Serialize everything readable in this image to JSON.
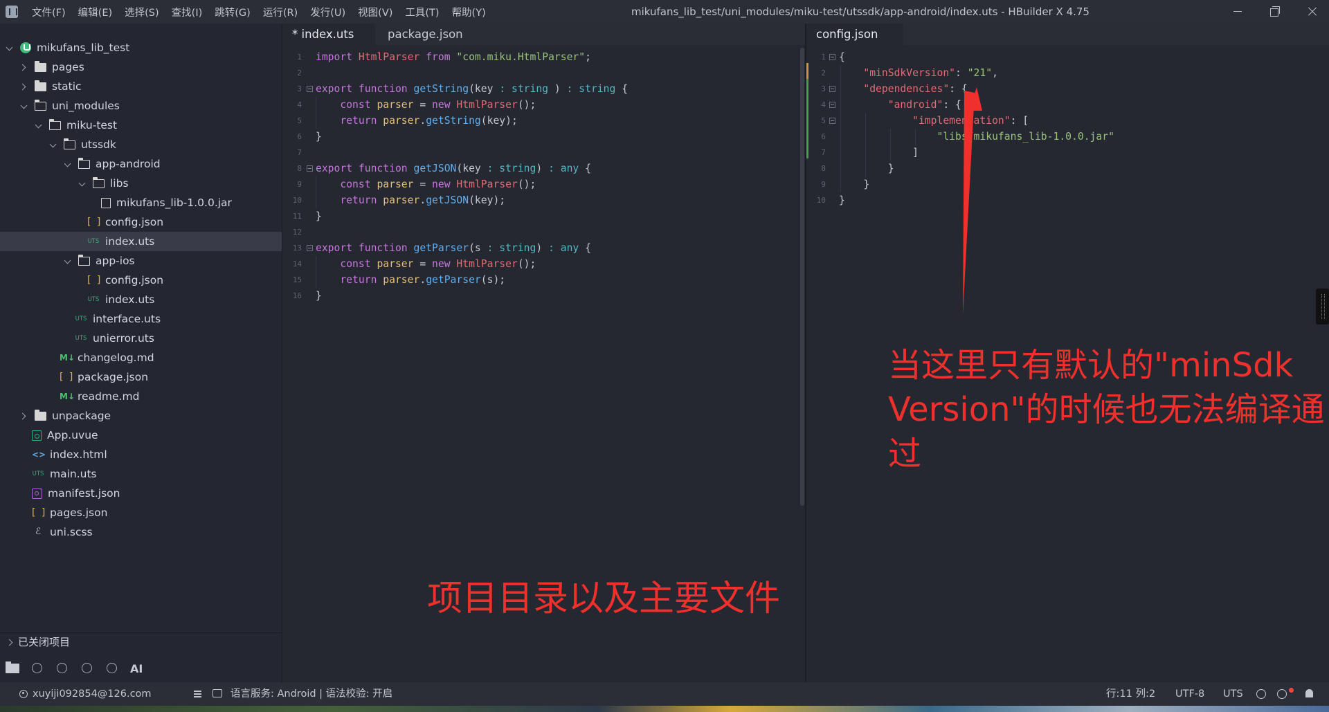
{
  "window": {
    "title": "mikufans_lib_test/uni_modules/miku-test/utssdk/app-android/index.uts - HBuilder X 4.75"
  },
  "menu": [
    "文件(F)",
    "编辑(E)",
    "选择(S)",
    "查找(I)",
    "跳转(G)",
    "运行(R)",
    "发行(U)",
    "视图(V)",
    "工具(T)",
    "帮助(Y)"
  ],
  "sidebar": {
    "tree": [
      {
        "label": "mikufans_lib_test",
        "icon": "project-icon",
        "expand": "down"
      },
      {
        "label": "pages",
        "icon": "folder-icon",
        "expand": "right"
      },
      {
        "label": "static",
        "icon": "folder-icon",
        "expand": "right"
      },
      {
        "label": "uni_modules",
        "icon": "folder-open-icon",
        "expand": "down"
      },
      {
        "label": "miku-test",
        "icon": "folder-open-icon",
        "expand": "down"
      },
      {
        "label": "utssdk",
        "icon": "folder-open-icon",
        "expand": "down"
      },
      {
        "label": "app-android",
        "icon": "folder-open-icon",
        "expand": "down"
      },
      {
        "label": "libs",
        "icon": "folder-open-icon",
        "expand": "down"
      },
      {
        "label": "mikufans_lib-1.0.0.jar",
        "icon": "jar-file-icon",
        "expand": "none"
      },
      {
        "label": "config.json",
        "icon": "json-file-icon",
        "expand": "none"
      },
      {
        "label": "index.uts",
        "icon": "uts-file-icon",
        "expand": "none",
        "selected": true
      },
      {
        "label": "app-ios",
        "icon": "folder-open-icon",
        "expand": "down"
      },
      {
        "label": "config.json",
        "icon": "json-file-icon",
        "expand": "none"
      },
      {
        "label": "index.uts",
        "icon": "uts-file-icon",
        "expand": "none"
      },
      {
        "label": "interface.uts",
        "icon": "uts-file-icon",
        "expand": "none"
      },
      {
        "label": "unierror.uts",
        "icon": "uts-file-icon",
        "expand": "none"
      },
      {
        "label": "changelog.md",
        "icon": "markdown-file-icon",
        "expand": "none"
      },
      {
        "label": "package.json",
        "icon": "json-file-icon",
        "expand": "none"
      },
      {
        "label": "readme.md",
        "icon": "markdown-file-icon",
        "expand": "none"
      },
      {
        "label": "unpackage",
        "icon": "folder-icon",
        "expand": "right"
      },
      {
        "label": "App.uvue",
        "icon": "uvue-file-icon",
        "expand": "none"
      },
      {
        "label": "index.html",
        "icon": "html-file-icon",
        "expand": "none"
      },
      {
        "label": "main.uts",
        "icon": "uts-file-icon",
        "expand": "none"
      },
      {
        "label": "manifest.json",
        "icon": "manifest-file-icon",
        "expand": "none"
      },
      {
        "label": "pages.json",
        "icon": "json-file-icon",
        "expand": "none"
      },
      {
        "label": "uni.scss",
        "icon": "scss-file-icon",
        "expand": "none"
      }
    ],
    "icon_glyphs": {
      "json": "[ ]",
      "uts": "UTS",
      "md": "M↓",
      "html": "<>",
      "scss": "ℰ"
    },
    "closed_projects": "已关闭项目",
    "toolbar_ai": "AI"
  },
  "left_editor": {
    "tabs": [
      "* index.uts",
      "package.json"
    ],
    "lines": [
      [
        [
          "kw",
          "import "
        ],
        [
          "cls",
          "HtmlParser "
        ],
        [
          "kw",
          "from "
        ],
        [
          "str",
          "\"com.miku.HtmlParser\""
        ],
        [
          "",
          "; "
        ]
      ],
      [],
      [
        [
          "kw",
          "export "
        ],
        [
          "kw",
          "function "
        ],
        [
          "fn",
          "getString"
        ],
        [
          "",
          "(key "
        ],
        [
          "ty",
          ": string"
        ],
        [
          "",
          " ) "
        ],
        [
          "ty",
          ": string "
        ],
        [
          "",
          "{"
        ]
      ],
      [
        [
          "",
          "    "
        ],
        [
          "kw",
          "const "
        ],
        [
          "id",
          "parser "
        ],
        [
          "",
          "= "
        ],
        [
          "kw",
          "new "
        ],
        [
          "cls",
          "HtmlParser"
        ],
        [
          "",
          "();"
        ]
      ],
      [
        [
          "",
          "    "
        ],
        [
          "kw",
          "return "
        ],
        [
          "id",
          "parser"
        ],
        [
          "",
          "."
        ],
        [
          "fn",
          "getString"
        ],
        [
          "",
          "(key);"
        ]
      ],
      [
        [
          "",
          "}"
        ]
      ],
      [],
      [
        [
          "kw",
          "export "
        ],
        [
          "kw",
          "function "
        ],
        [
          "fn",
          "getJSON"
        ],
        [
          "",
          "(key "
        ],
        [
          "ty",
          ": string"
        ],
        [
          "",
          ") "
        ],
        [
          "ty",
          ": any "
        ],
        [
          "",
          "{"
        ]
      ],
      [
        [
          "",
          "    "
        ],
        [
          "kw",
          "const "
        ],
        [
          "id",
          "parser "
        ],
        [
          "",
          "= "
        ],
        [
          "kw",
          "new "
        ],
        [
          "cls",
          "HtmlParser"
        ],
        [
          "",
          "();"
        ]
      ],
      [
        [
          "",
          "    "
        ],
        [
          "kw",
          "return "
        ],
        [
          "id",
          "parser"
        ],
        [
          "",
          "."
        ],
        [
          "fn",
          "getJSON"
        ],
        [
          "",
          "(key);"
        ]
      ],
      [
        [
          "",
          "}"
        ]
      ],
      [],
      [
        [
          "kw",
          "export "
        ],
        [
          "kw",
          "function "
        ],
        [
          "fn",
          "getParser"
        ],
        [
          "",
          "(s "
        ],
        [
          "ty",
          ": string"
        ],
        [
          "",
          ") "
        ],
        [
          "ty",
          ": any "
        ],
        [
          "",
          "{"
        ]
      ],
      [
        [
          "",
          "    "
        ],
        [
          "kw",
          "const "
        ],
        [
          "id",
          "parser "
        ],
        [
          "",
          "= "
        ],
        [
          "kw",
          "new "
        ],
        [
          "cls",
          "HtmlParser"
        ],
        [
          "",
          "();"
        ]
      ],
      [
        [
          "",
          "    "
        ],
        [
          "kw",
          "return "
        ],
        [
          "id",
          "parser"
        ],
        [
          "",
          "."
        ],
        [
          "fn",
          "getParser"
        ],
        [
          "",
          "(s);"
        ]
      ],
      [
        [
          "",
          "}"
        ]
      ]
    ]
  },
  "right_editor": {
    "tabs": [
      "config.json"
    ],
    "lines": [
      [
        [
          "",
          "{"
        ]
      ],
      [
        [
          "",
          "    "
        ],
        [
          "key",
          "\"minSdkVersion\""
        ],
        [
          "",
          ": "
        ],
        [
          "str",
          "\"21\""
        ],
        [
          "",
          ","
        ]
      ],
      [
        [
          "",
          "    "
        ],
        [
          "key",
          "\"dependencies\""
        ],
        [
          "",
          ": {"
        ]
      ],
      [
        [
          "",
          "        "
        ],
        [
          "key",
          "\"android\""
        ],
        [
          "",
          ": {"
        ]
      ],
      [
        [
          "",
          "            "
        ],
        [
          "key",
          "\"implementation\""
        ],
        [
          "",
          ": ["
        ]
      ],
      [
        [
          "",
          "                "
        ],
        [
          "str",
          "\"libs/mikufans_lib-1.0.0.jar\""
        ]
      ],
      [
        [
          "",
          "            ]"
        ]
      ],
      [
        [
          "",
          "        }"
        ]
      ],
      [
        [
          "",
          "    }"
        ]
      ],
      [
        [
          "",
          "}"
        ]
      ]
    ]
  },
  "annotations": {
    "right": "当这里只有默认的\"minSdk Version\"的时候也无法编译通过",
    "left": "项目目录以及主要文件",
    "color": "#f0302c"
  },
  "statusbar": {
    "user": "xuyiji092854@126.com",
    "language_service": "语言服务: Android | 语法校验: 开启",
    "cursor": "行:11  列:2",
    "encoding": "UTF-8",
    "language": "UTS"
  }
}
